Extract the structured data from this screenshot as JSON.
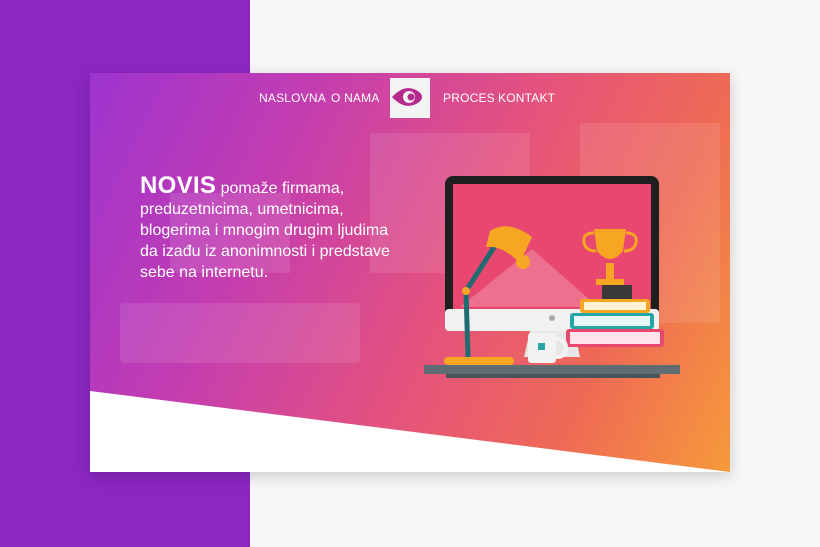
{
  "nav": {
    "links_left": [
      "NASLOVNA",
      "O NAMA"
    ],
    "links_right": [
      "PROCES",
      "KONTAKT"
    ],
    "logo_icon": "eye-icon"
  },
  "hero": {
    "brand": "NOVIS",
    "text": " pomaže firmama, preduzetnicima, umetnicima, blogerima i mnogim drugim ljudima da izađu iz anonimnosti i predstave sebe na internetu."
  },
  "colors": {
    "side_purple": "#8b27c2",
    "gradient_start": "#9d34cf",
    "gradient_end": "#f69a3a",
    "logo_eye": "#b52a8c"
  },
  "illustration": {
    "icons": [
      "monitor-icon",
      "desk-lamp-icon",
      "trophy-icon",
      "books-icon",
      "mug-icon",
      "desk-icon"
    ]
  }
}
